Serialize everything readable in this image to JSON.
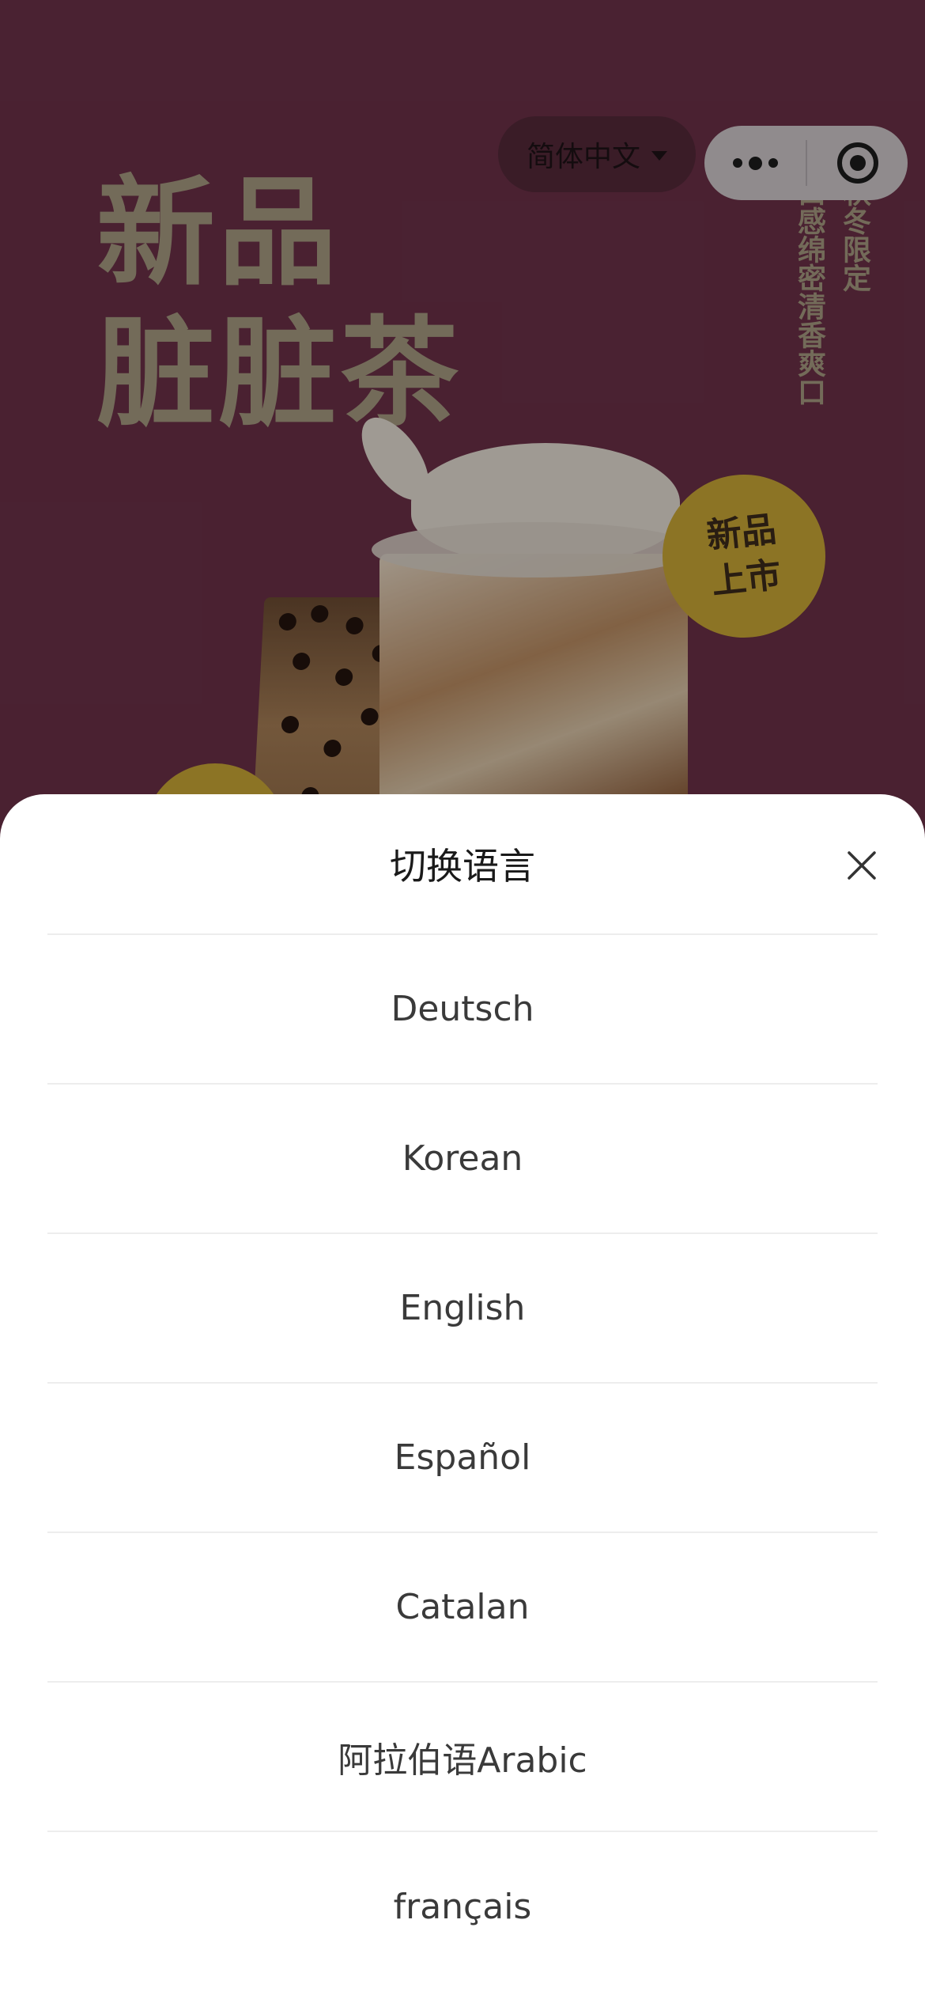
{
  "banner": {
    "headline_line1": "新品",
    "headline_line2": "脏脏茶",
    "vertical_text_1": "秋冬限定",
    "vertical_text_2": "口感绵密清香爽口",
    "badge_text_line1": "新品",
    "badge_text_line2": "上市"
  },
  "top_bar": {
    "language_selector": "简体中文",
    "more_icon": "more-dots-icon",
    "close_miniprogram_icon": "target-icon"
  },
  "sheet": {
    "title": "切换语言",
    "close_icon": "close-icon",
    "options": [
      "Deutsch",
      "Korean",
      "English",
      "Español",
      "Catalan",
      "阿拉伯语Arabic",
      "français"
    ]
  },
  "colors": {
    "banner_bg": "#6a3047",
    "badge": "#c9a635",
    "sheet_bg": "#ffffff",
    "divider": "#ededed"
  }
}
